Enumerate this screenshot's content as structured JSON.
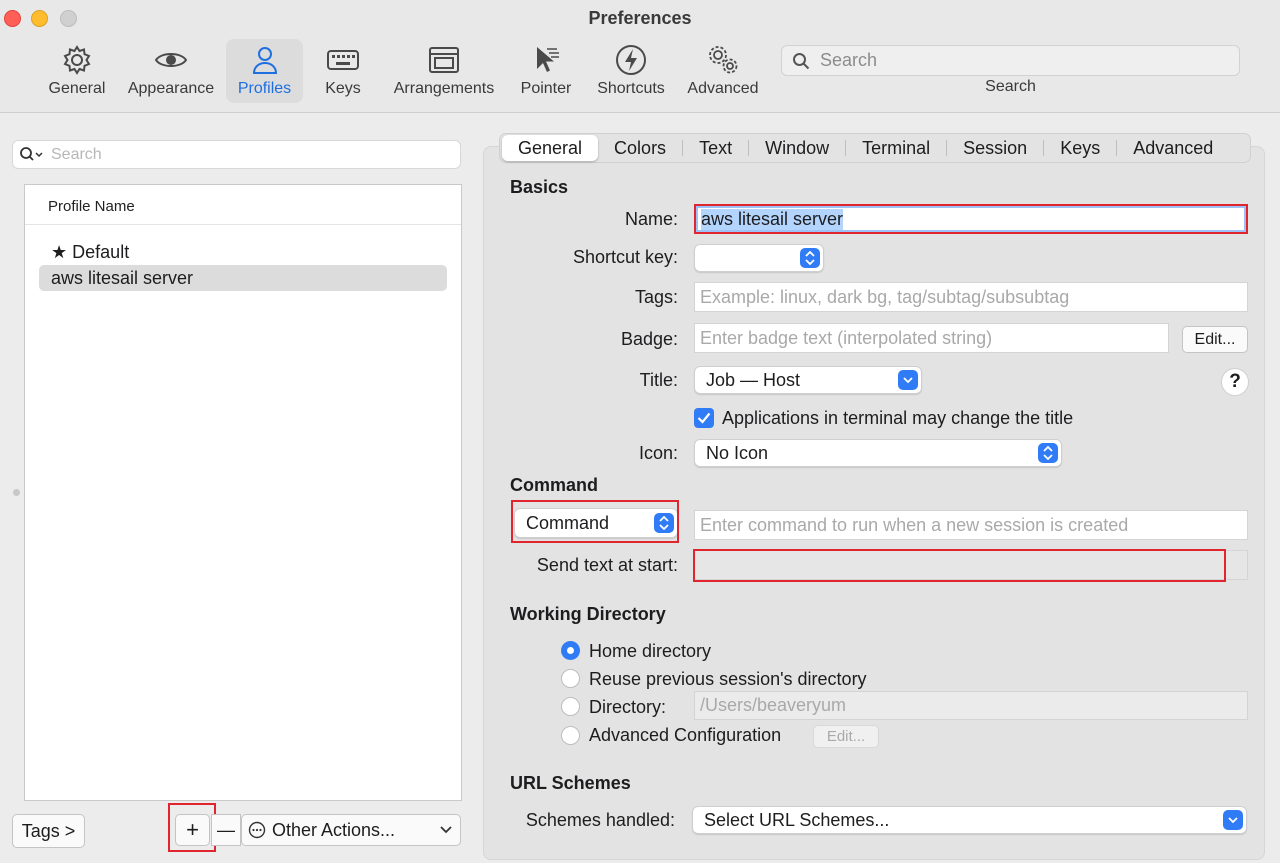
{
  "window": {
    "title": "Preferences"
  },
  "toolbar": {
    "items": [
      {
        "label": "General",
        "icon": "gear-icon"
      },
      {
        "label": "Appearance",
        "icon": "eye-icon"
      },
      {
        "label": "Profiles",
        "icon": "person-icon",
        "active": true
      },
      {
        "label": "Keys",
        "icon": "keyboard-icon"
      },
      {
        "label": "Arrangements",
        "icon": "window-icon"
      },
      {
        "label": "Pointer",
        "icon": "pointer-icon"
      },
      {
        "label": "Shortcuts",
        "icon": "bolt-icon"
      },
      {
        "label": "Advanced",
        "icon": "gears-icon"
      }
    ],
    "search_placeholder": "Search",
    "search_label": "Search"
  },
  "profiles": {
    "search_placeholder": "Search",
    "column_header": "Profile Name",
    "items": [
      {
        "name": "Default",
        "default": true
      },
      {
        "name": "aws litesail server",
        "selected": true
      }
    ],
    "tags_button": "Tags >",
    "add_button": "+",
    "remove_button": "—",
    "other_actions": "Other Actions..."
  },
  "tabs": [
    "General",
    "Colors",
    "Text",
    "Window",
    "Terminal",
    "Session",
    "Keys",
    "Advanced"
  ],
  "basics": {
    "title": "Basics",
    "name_label": "Name:",
    "name_value": "aws litesail server",
    "shortcut_label": "Shortcut key:",
    "shortcut_value": "",
    "tags_label": "Tags:",
    "tags_placeholder": "Example: linux, dark bg, tag/subtag/subsubtag",
    "badge_label": "Badge:",
    "badge_placeholder": "Enter badge text (interpolated string)",
    "badge_edit": "Edit...",
    "title_label": "Title:",
    "title_value": "Job — Host",
    "help": "?",
    "apps_change_title": "Applications in terminal may change the title",
    "apps_change_title_checked": true,
    "icon_label": "Icon:",
    "icon_value": "No Icon"
  },
  "command": {
    "title": "Command",
    "mode": "Command",
    "command_placeholder": "Enter command to run when a new session is created",
    "send_text_label": "Send text at start:",
    "send_text_value": ""
  },
  "working_directory": {
    "title": "Working Directory",
    "options": [
      "Home directory",
      "Reuse previous session's directory",
      "Directory:",
      "Advanced Configuration"
    ],
    "selected": "Home directory",
    "directory_value": "/Users/beaveryum",
    "edit": "Edit..."
  },
  "url_schemes": {
    "title": "URL Schemes",
    "label": "Schemes handled:",
    "value": "Select URL Schemes..."
  },
  "colors": {
    "accent": "#2f7cf6",
    "highlight": "#e0252f",
    "active_tab_text": "#1f6fe0"
  }
}
